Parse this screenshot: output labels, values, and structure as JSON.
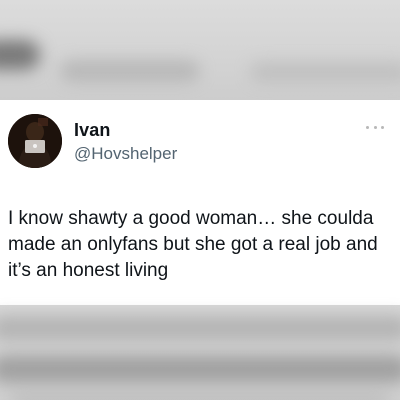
{
  "tweet": {
    "author_name": "Ivan",
    "author_handle": "@Hovshelper",
    "text": "I know shawty a good woman… she coulda made an onlyfans but she got a real job and it’s an honest living",
    "avatar_icon": "profile-avatar-icon",
    "menu_icon": "more-options-icon"
  },
  "colors": {
    "name": "#0f1419",
    "handle": "#536471",
    "text": "#0f1419",
    "card_background": "#ffffff",
    "page_background": "#cfcfcf"
  }
}
